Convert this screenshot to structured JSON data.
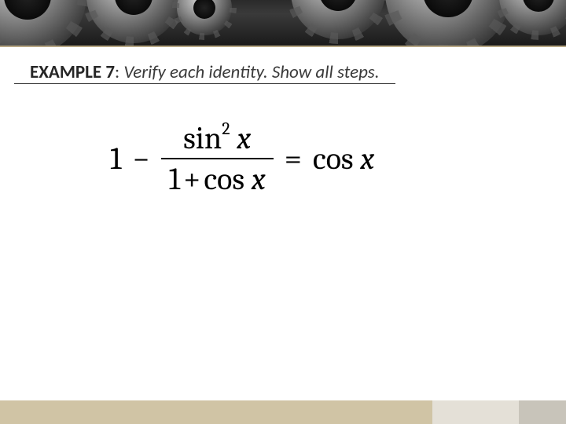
{
  "header": {
    "label": "EXAMPLE 7",
    "separator": ": ",
    "instruction": "Verify each identity. Show all steps."
  },
  "equation": {
    "lhs_lead": "1",
    "minus": "−",
    "numerator_fn": "sin",
    "numerator_exp": "2",
    "numerator_var": "x",
    "denominator_lead": "1",
    "denominator_op": "+",
    "denominator_fn": "cos",
    "denominator_var": "x",
    "equals": "=",
    "rhs_fn": "cos",
    "rhs_var": "x"
  }
}
